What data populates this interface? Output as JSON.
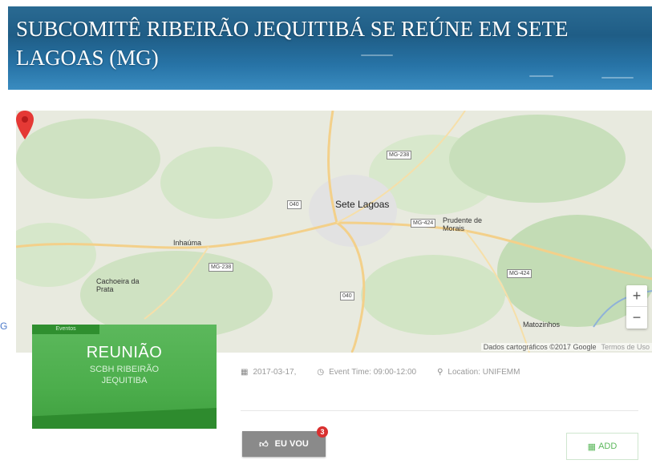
{
  "banner": {
    "title": "SUBCOMITÊ RIBEIRÃO JEQUITIBÁ SE REÚNE EM SETE LAGOAS (MG)"
  },
  "map": {
    "cities": [
      {
        "key": "sete_lagoas",
        "label": "Sete Lagoas"
      },
      {
        "key": "prudente",
        "label": "Prudente de Morais"
      },
      {
        "key": "inhauma",
        "label": "Inhaúma"
      },
      {
        "key": "cachoeira",
        "label": "Cachoeira da Prata"
      },
      {
        "key": "matozinhos",
        "label": "Matozinhos"
      }
    ],
    "shields": [
      "MG-238",
      "040",
      "MG-424",
      "MG-238b",
      "040b",
      "MG-424b"
    ],
    "zoom_in": "+",
    "zoom_out": "−",
    "attribution": "Dados cartográficos ©2017 Google",
    "terms": "Termos de Uso",
    "google_mark": "G"
  },
  "card": {
    "tag": "Eventos",
    "title": "REUNIÃO",
    "subtitle_line1": "SCBH RIBEIRÃO",
    "subtitle_line2": "JEQUITIBA"
  },
  "meta": {
    "date": "2017-03-17,",
    "time": "Event Time: 09:00-12:00",
    "location": "Location: UNIFEMM"
  },
  "actions": {
    "go_label": "EU VOU",
    "go_count": "3",
    "add_label": "ADD"
  },
  "colors": {
    "accent_green": "#5cb85c",
    "banner_blue": "#2773a6",
    "badge_red": "#d9302f"
  }
}
